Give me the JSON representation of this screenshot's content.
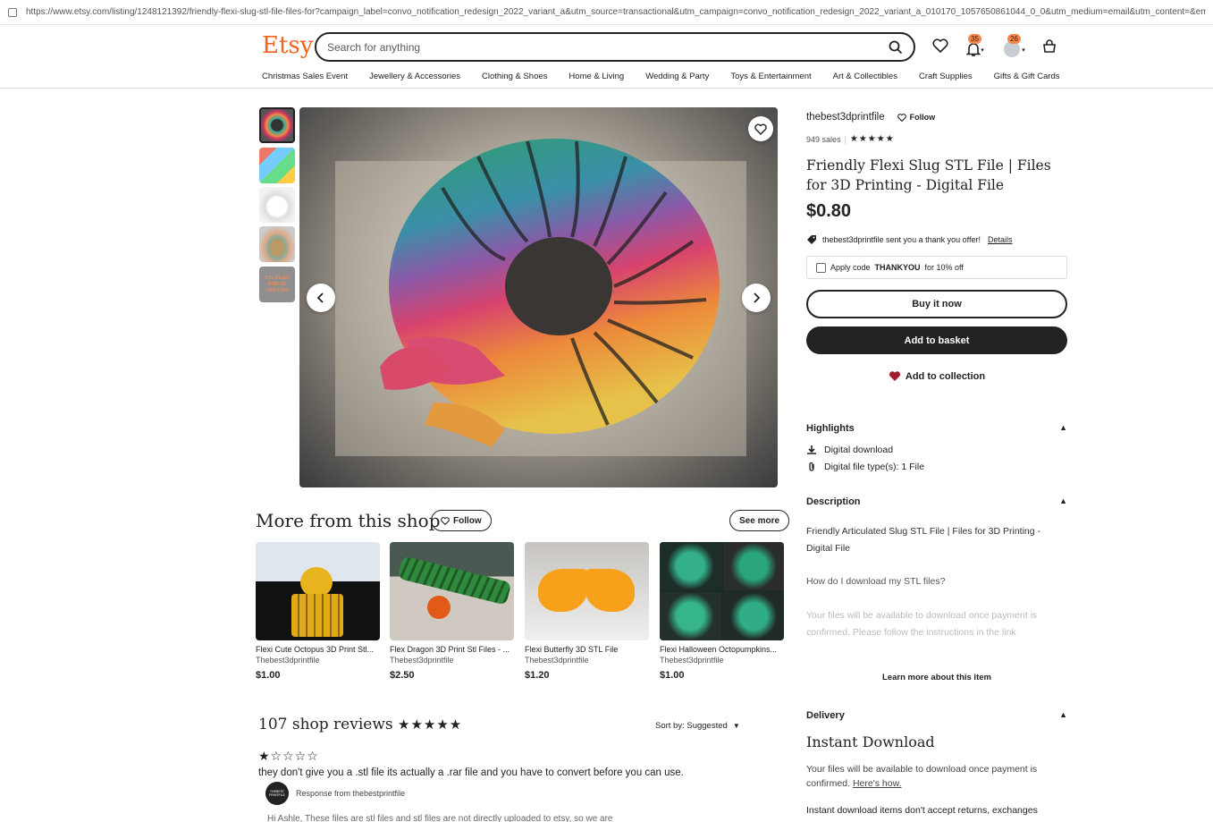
{
  "browser": {
    "url": "https://www.etsy.com/listing/1248121392/friendly-flexi-slug-stl-file-files-for?campaign_label=convo_notification_redesign_2022_variant_a&utm_source=transactional&utm_campaign=convo_notification_redesign_2022_variant_a_010170_1057650861044_0_0&utm_medium=email&utm_content=&email_sent=16673..."
  },
  "header": {
    "logo": "Etsy",
    "search_placeholder": "Search for anything",
    "notifications_count": "35",
    "account_count": "26"
  },
  "nav": [
    "Christmas Sales Event",
    "Jewellery & Accessories",
    "Clothing & Shoes",
    "Home & Living",
    "Wedding & Party",
    "Toys & Entertainment",
    "Art & Collectibles",
    "Craft Supplies",
    "Gifts & Gift Cards"
  ],
  "gallery": {
    "thumb5_text": "STL FILES FOR 3D PRINTING"
  },
  "shop": {
    "name": "thebest3dprintfile",
    "follow": "Follow",
    "sales": "949 sales",
    "rating_stars": "★★★★★"
  },
  "product": {
    "title": "Friendly Flexi Slug STL File | Files for 3D Printing - Digital File",
    "price": "$0.80",
    "offer_text": "thebest3dprintfile sent you a thank you offer!",
    "offer_link": "Details",
    "code_prefix": "Apply code",
    "code": "THANKYOU",
    "code_suffix": "for 10% off",
    "buy_now": "Buy it now",
    "add_basket": "Add to basket",
    "add_collection": "Add to collection"
  },
  "highlights": {
    "title": "Highlights",
    "items": [
      "Digital download",
      "Digital file type(s): 1 File"
    ]
  },
  "description": {
    "title": "Description",
    "p1": "Friendly Articulated Slug STL File | Files for 3D Printing - Digital File",
    "p2": "How do I download my STL files?",
    "p3": "Your files will be available to download once payment is confirmed. Please follow the instructions in the link",
    "learn_more": "Learn more about this item"
  },
  "delivery": {
    "title": "Delivery",
    "heading": "Instant Download",
    "text": "Your files will be available to download once payment is confirmed.",
    "link": "Here's how.",
    "text2": "Instant download items don't accept returns, exchanges"
  },
  "more": {
    "title": "More from this shop",
    "follow": "Follow",
    "see_more": "See more",
    "items": [
      {
        "title": "Flexi Cute Octopus 3D Print Stl...",
        "shop": "Thebest3dprintfile",
        "price": "$1.00"
      },
      {
        "title": "Flex Dragon 3D Print Stl Files - ...",
        "shop": "Thebest3dprintfile",
        "price": "$2.50"
      },
      {
        "title": "Flexi Butterfly 3D STL File",
        "shop": "Thebest3dprintfile",
        "price": "$1.20"
      },
      {
        "title": "Flexi Halloween Octopumpkins...",
        "shop": "Thebest3dprintfile",
        "price": "$1.00"
      }
    ]
  },
  "reviews": {
    "title": "107 shop reviews",
    "stars": "★★★★★",
    "sort_label": "Sort by: Suggested",
    "review_stars": "★☆☆☆☆",
    "review_text": "they don't give you a .stl file its actually a .rar file and you have to convert before you can use.",
    "response_label": "Response from thebestprintfile",
    "avatar_text": "THEBEST PRINTFILE",
    "response_text": "Hi Ashle, These files are stl files and stl files are not directly uploaded to etsy, so we are"
  },
  "colors": {
    "brand": "#f1641e",
    "dark": "#222222",
    "heart": "#a61a2e"
  }
}
